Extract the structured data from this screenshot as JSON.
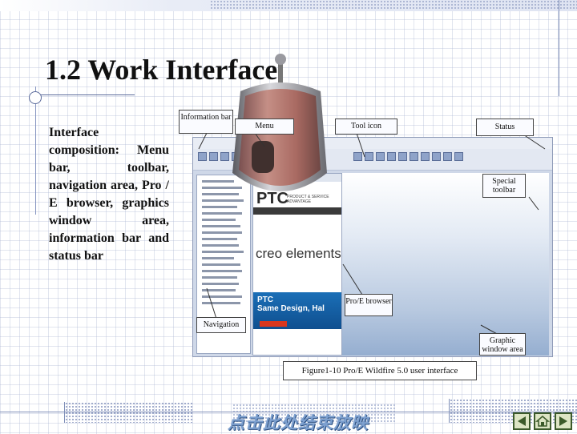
{
  "slide": {
    "title": "1.2 Work Interface",
    "description": "Interface composition: Menu bar, toolbar, navigation area, Pro / E browser, graphics window area, information bar and status bar"
  },
  "callouts": {
    "information_bar": "Information bar",
    "menu": "Menu",
    "tool_icon": "Tool icon",
    "status": "Status",
    "special_toolbar": "Special toolbar",
    "pro_e_browser": "Pro/E browser",
    "navigation": "Navigation",
    "graphic_window_area": "Graphic window area"
  },
  "screenshot": {
    "ptc_logo": "PTC",
    "ptc_tagline": "PRODUCT & SERVICE ADVANTAGE",
    "creo_text": "creo elements",
    "banner_title": "PTC",
    "banner_text": "Same Design, Hal"
  },
  "caption": "Figure1-10 Pro/E Wildfire 5.0 user interface",
  "footer": {
    "end_show_label": "点击此处结束放映"
  },
  "nav_buttons": {
    "prev_icon": "triangle-left-icon",
    "home_icon": "home-icon",
    "next_icon": "triangle-right-icon"
  },
  "colors": {
    "title": "#111111",
    "accent_blue": "#7da0cf",
    "nav_button_fill": "#dde5c4",
    "nav_button_border": "#3c5a2a"
  }
}
